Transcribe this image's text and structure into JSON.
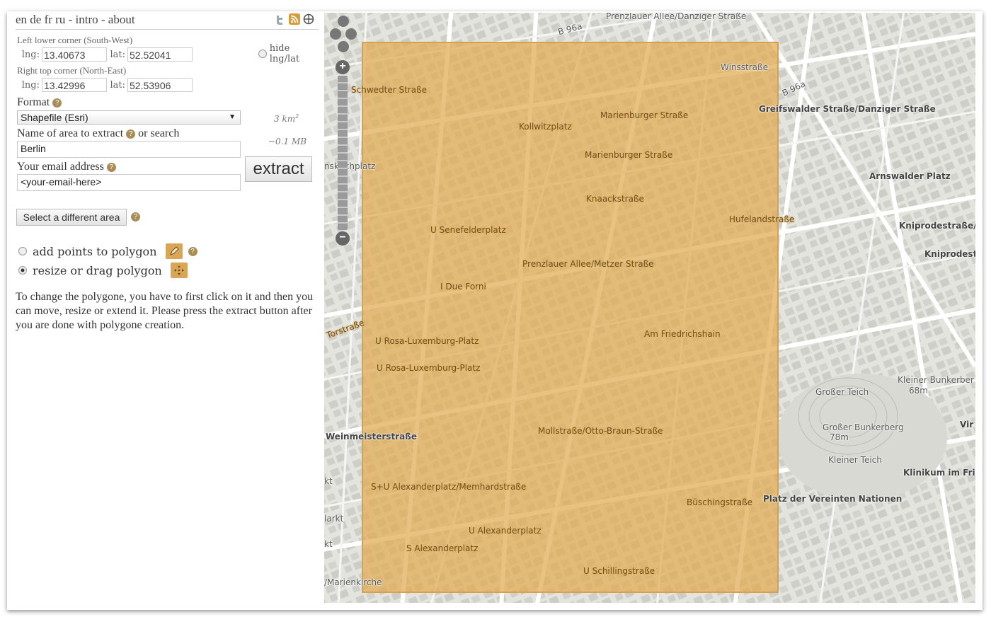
{
  "nav": {
    "langs": "en de fr ru",
    "sep1": " - ",
    "intro": "intro",
    "sep2": " - ",
    "about": "about"
  },
  "icons": {
    "twitter": "twitter-icon",
    "rss": "rss-icon",
    "target": "crosshair-icon"
  },
  "coords": {
    "sw_label": "Left lower corner (South-West)",
    "ne_label": "Right top corner (North-East)",
    "lng_label": "lng:",
    "lat_label": "lat:",
    "sw_lng": "13.40673",
    "sw_lat": "52.52041",
    "ne_lng": "13.42996",
    "ne_lat": "52.53906",
    "hide_label": "hide lng/lat"
  },
  "form": {
    "format_label": "Format",
    "format_value": "Shapefile (Esri)",
    "area_value": "3 km",
    "area_unit_sup": "2",
    "size_value": "~0.1 MB",
    "name_label": "Name of area to extract",
    "name_suffix": "or search",
    "name_value": "Berlin",
    "email_label": "Your email address",
    "email_value": "<your-email-here>",
    "extract_label": "extract",
    "select_area_label": "Select a different area"
  },
  "options": {
    "add_points": "add points to polygon",
    "resize": "resize or drag polygon",
    "selected": "resize"
  },
  "description": "To change the polygone, you have to first click on it and then you can move, resize or extend it. Please press the extract button after you are done with polygone creation.",
  "map": {
    "selection_color": "#e1aa50",
    "labels": {
      "l1": "Prenzlauer Allee/Danziger Straße",
      "l2": "Winsstraße",
      "l3": "Schwedter Straße",
      "l4": "Greifswalder Straße/Danziger Straße",
      "l5": "Marienburger Straße",
      "l6": "Kollwitzplatz",
      "l7": "Marienburger Straße",
      "l8": "Arnswalder Platz",
      "l9": "nskirchplatz",
      "l10": "Knaackstraße",
      "l11": "Hufelandstraße",
      "l12": "Kniprodestraße/D",
      "l13": "U Senefelderplatz",
      "l14": "Kniprodestr",
      "l15": "Prenzlauer Allee/Metzer Straße",
      "l16": "I Due Forni",
      "l17": "Am Friedrichshain",
      "l18": "U Rosa-Luxemburg-Platz",
      "l19": "U Rosa-Luxemburg-Platz",
      "l20": "Kleiner Bunkerber",
      "l21": "68m",
      "l22": "Großer Teich",
      "l23": "Großer Bunkerberg",
      "l24": "78m",
      "l25": "Vir",
      "l26": "Mollstraße/Otto-Braun-Straße",
      "l27": "Weinmeisterstraße",
      "l28": "Kleiner Teich",
      "l29": "Klinikum im Frie",
      "l30": "S+U Alexanderplatz/Memhardstraße",
      "l31": "Büschingstraße",
      "l32": "Platz der Vereinten Nationen",
      "l33": "kt",
      "l34": "larkt",
      "l35": "U Alexanderplatz",
      "l36": "S Alexanderplatz",
      "l37": "U Schillingstraße",
      "l38": "/Marienkirche",
      "l39": "Torstraße",
      "l40": "B 96a",
      "l41": "B 96a"
    },
    "zoom_in": "+",
    "zoom_out": "−"
  }
}
